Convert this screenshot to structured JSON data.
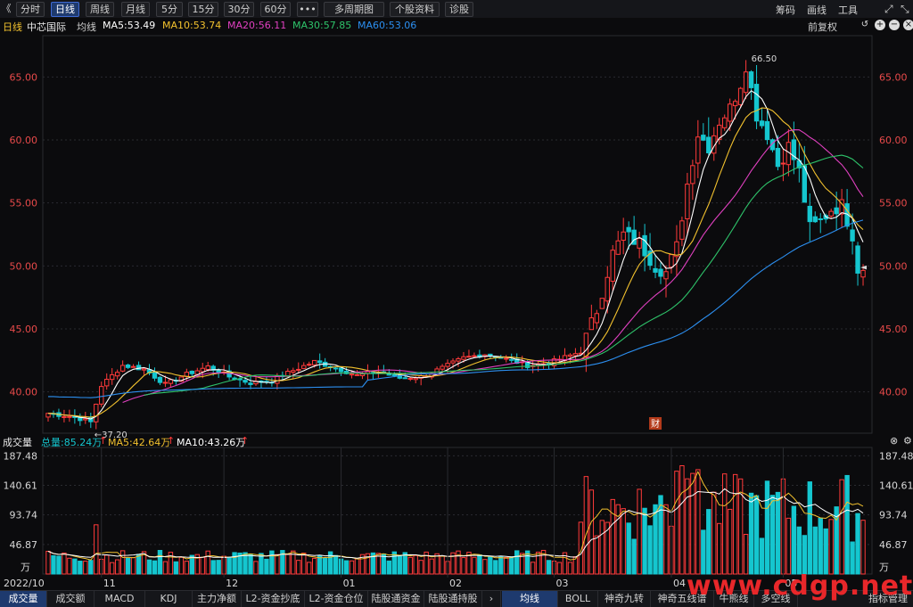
{
  "toolbar": {
    "back": "《",
    "tabs": [
      "分时",
      "日线",
      "周线",
      "月线",
      "5分",
      "15分",
      "30分",
      "60分",
      "•••",
      "多周期图",
      "个股资料",
      "诊股"
    ],
    "active_tab": "日线",
    "right": [
      "筹码",
      "画线",
      "工具"
    ]
  },
  "legend": {
    "period": "日线",
    "stock": "中芯国际",
    "ma_label": "均线",
    "ma5": "MA5:53.49",
    "ma10": "MA10:53.74",
    "ma20": "MA20:56.11",
    "ma30": "MA30:57.85",
    "ma60": "MA60:53.06",
    "adjust": "前复权"
  },
  "colors": {
    "up": "#ff3a3a",
    "down": "#15c6cf",
    "ma5": "#ffffff",
    "ma10": "#f2c12e",
    "ma20": "#e040c0",
    "ma30": "#2ec36a",
    "ma60": "#2c8ff0",
    "axis": "#e84a4a"
  },
  "price_axis": {
    "ticks": [
      "65.00",
      "60.00",
      "55.00",
      "50.00",
      "45.00",
      "40.00"
    ],
    "high_label": "66.50",
    "low_label": "37.20",
    "current_marker": "◄",
    "fin_badge": "财"
  },
  "volume_legend": {
    "title": "成交量",
    "total": "总量:85.24万",
    "ma5": "MA5:42.64万",
    "ma10": "MA10:43.26万"
  },
  "volume_axis": {
    "ticks": [
      "187.48",
      "140.61",
      "93.74",
      "46.87"
    ],
    "unit": "万"
  },
  "x_axis": {
    "labels": [
      "2022/10",
      "11",
      "12",
      "01",
      "02",
      "03",
      "04",
      "05"
    ]
  },
  "bottom_tabs": {
    "left": [
      "成交量",
      "成交额",
      "MACD",
      "KDJ",
      "主力净额",
      "L2-资金抄底",
      "L2-资金仓位",
      "陆股通资金",
      "陆股通持股"
    ],
    "right": [
      "均线",
      "BOLL",
      "神奇九转",
      "神奇五线谱",
      "牛熊线",
      "多空线",
      "指标管理"
    ],
    "active_left": "成交量",
    "active_right": "均线"
  },
  "watermark": "www.cdgp.net",
  "chart_data": {
    "type": "candlestick",
    "title": "中芯国际 日线",
    "ylim": [
      37,
      68
    ],
    "x_labels": [
      "2022/10",
      "11",
      "12",
      "01",
      "02",
      "03",
      "04",
      "05"
    ],
    "annotations": [
      {
        "label": "66.50",
        "kind": "high"
      },
      {
        "label": "37.20",
        "kind": "low"
      }
    ],
    "price_anchors": [
      [
        0,
        38.3
      ],
      [
        5,
        38.0
      ],
      [
        8,
        37.6
      ],
      [
        10,
        40.5
      ],
      [
        14,
        42.1
      ],
      [
        18,
        41.8
      ],
      [
        22,
        40.6
      ],
      [
        26,
        41.4
      ],
      [
        30,
        42.0
      ],
      [
        34,
        41.2
      ],
      [
        38,
        40.7
      ],
      [
        42,
        40.9
      ],
      [
        46,
        41.7
      ],
      [
        50,
        42.4
      ],
      [
        54,
        41.9
      ],
      [
        58,
        41.3
      ],
      [
        62,
        41.6
      ],
      [
        66,
        41.1
      ],
      [
        70,
        41.2
      ],
      [
        74,
        41.9
      ],
      [
        78,
        42.7
      ],
      [
        82,
        43.0
      ],
      [
        86,
        42.6
      ],
      [
        90,
        42.1
      ],
      [
        94,
        42.3
      ],
      [
        98,
        42.9
      ],
      [
        100,
        43.2
      ],
      [
        103,
        46.5
      ],
      [
        106,
        51.0
      ],
      [
        108,
        52.5
      ],
      [
        111,
        51.8
      ],
      [
        114,
        50.0
      ],
      [
        116,
        49.5
      ],
      [
        118,
        51.5
      ],
      [
        120,
        56.5
      ],
      [
        122,
        60.5
      ],
      [
        124,
        59.5
      ],
      [
        126,
        61.5
      ],
      [
        128,
        62.5
      ],
      [
        130,
        64.5
      ],
      [
        131,
        66.0
      ],
      [
        133,
        62.0
      ],
      [
        135,
        60.5
      ],
      [
        137,
        58.0
      ],
      [
        139,
        59.5
      ],
      [
        141,
        57.5
      ],
      [
        143,
        53.0
      ],
      [
        145,
        53.5
      ],
      [
        147,
        54.5
      ],
      [
        149,
        54.8
      ],
      [
        151,
        52.5
      ],
      [
        152,
        49.8
      ]
    ],
    "volume": {
      "ylim": [
        0,
        195
      ],
      "unit": "万",
      "last_total": 85.24,
      "ma5": 42.64,
      "ma10": 43.26
    },
    "series_last": {
      "MA5": 53.49,
      "MA10": 53.74,
      "MA20": 56.11,
      "MA30": 57.85,
      "MA60": 53.06
    }
  }
}
